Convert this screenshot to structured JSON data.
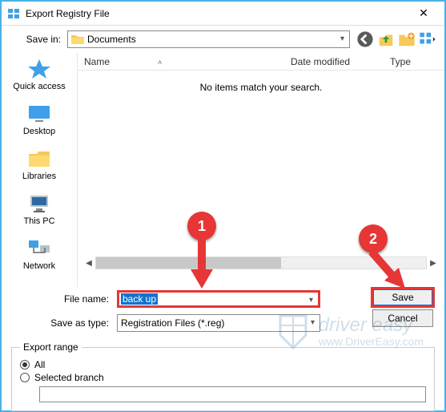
{
  "window": {
    "title": "Export Registry File"
  },
  "topbar": {
    "save_in_label": "Save in:",
    "save_in_value": "Documents"
  },
  "sidebar": {
    "items": [
      {
        "label": "Quick access"
      },
      {
        "label": "Desktop"
      },
      {
        "label": "Libraries"
      },
      {
        "label": "This PC"
      },
      {
        "label": "Network"
      }
    ]
  },
  "columns": {
    "name": "Name",
    "date": "Date modified",
    "type": "Type"
  },
  "empty_message": "No items match your search.",
  "form": {
    "file_name_label": "File name:",
    "file_name_value": "back up",
    "save_type_label": "Save as type:",
    "save_type_value": "Registration Files (*.reg)"
  },
  "buttons": {
    "save": "Save",
    "cancel": "Cancel"
  },
  "export_range": {
    "legend": "Export range",
    "all": "All",
    "selected": "Selected branch",
    "branch_value": ""
  },
  "callouts": {
    "one": "1",
    "two": "2"
  },
  "watermark": {
    "brand": "driver easy",
    "url": "www.DriverEasy.com"
  }
}
